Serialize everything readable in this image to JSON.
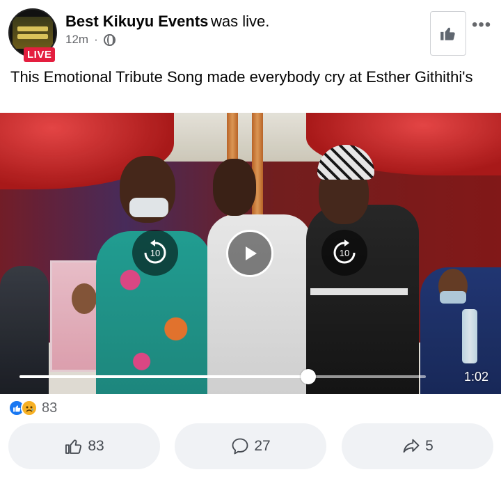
{
  "post": {
    "page_name": "Best Kikuyu Events",
    "status_text": "was live.",
    "time_ago": "12m",
    "separator": "·",
    "live_badge": "LIVE",
    "caption": "This Emotional Tribute Song made everybody cry at Esther Githithi's",
    "audience_icon": "globe-icon",
    "like_page_icon": "thumbs-up-icon",
    "more_icon": "more-options-icon"
  },
  "video": {
    "rewind_label": "10",
    "forward_label": "10",
    "progress": 0.71,
    "duration": "1:02"
  },
  "reactions": {
    "types": [
      "like",
      "sad"
    ],
    "total": "83"
  },
  "actions": {
    "like_count": "83",
    "comment_count": "27",
    "share_count": "5"
  },
  "colors": {
    "live_red": "#e41e3f",
    "like_blue": "#1877f2",
    "sad_yellow": "#f7b125",
    "button_bg": "#f0f2f5",
    "secondary_text": "#65676b"
  }
}
